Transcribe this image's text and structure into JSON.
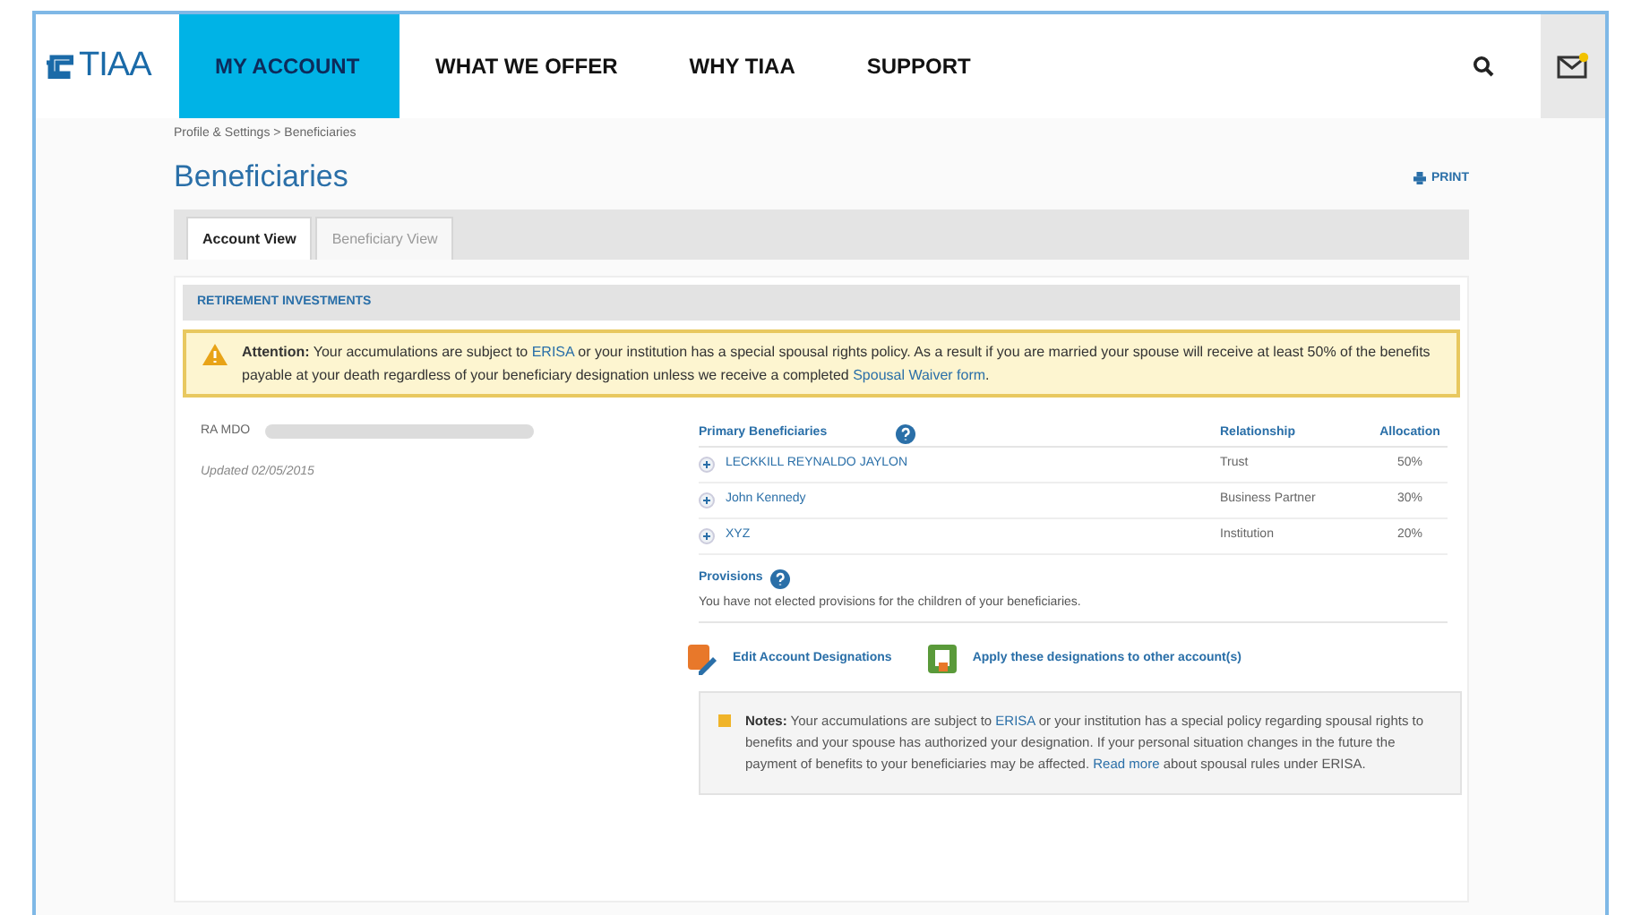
{
  "logo": "TIAA",
  "nav": [
    {
      "label": "MY ACCOUNT",
      "selected": true
    },
    {
      "label": "WHAT WE OFFER",
      "selected": false
    },
    {
      "label": "WHY TIAA",
      "selected": false
    },
    {
      "label": "SUPPORT",
      "selected": false
    }
  ],
  "breadcrumb": "Profile & Settings > Beneficiaries",
  "page_title": "Beneficiaries",
  "print": "PRINT",
  "tabs": [
    {
      "label": "Account View",
      "selected": true
    },
    {
      "label": "Beneficiary View",
      "selected": false
    }
  ],
  "section_title": "RETIREMENT INVESTMENTS",
  "attention": {
    "lead": "Attention:",
    "parts": [
      {
        "kind": "text",
        "text": " Your accumulations are subject to "
      },
      {
        "kind": "link",
        "text": "ERISA"
      },
      {
        "kind": "text",
        "text": " or your institution has a special spousal rights policy. As a result if you are married your spouse will receive at least 50% of the benefits payable at your death regardless of your beneficiary designation unless we receive a completed "
      },
      {
        "kind": "link",
        "text": "Spousal Waiver form"
      },
      {
        "kind": "text",
        "text": "."
      }
    ]
  },
  "account": {
    "label": "RA MDO",
    "updated": "Updated 02/05/2015"
  },
  "beneficiaries": {
    "columns": [
      "Primary Beneficiaries",
      "Relationship",
      "Allocation"
    ],
    "rows": [
      {
        "name": "LECKKILL REYNALDO JAYLON",
        "relationship": "Trust",
        "allocation": "50%"
      },
      {
        "name": "John Kennedy",
        "relationship": "Business Partner",
        "allocation": "30%"
      },
      {
        "name": "XYZ",
        "relationship": "Institution",
        "allocation": "20%"
      }
    ]
  },
  "provisions": {
    "title": "Provisions",
    "text": "You have not elected provisions for the children of your beneficiaries."
  },
  "actions": [
    "Edit Account Designations",
    "Apply these designations to other account(s)"
  ],
  "notes": {
    "lead": "Notes:",
    "parts": [
      {
        "kind": "text",
        "text": " Your accumulations are subject to "
      },
      {
        "kind": "link",
        "text": "ERISA"
      },
      {
        "kind": "text",
        "text": " or your institution has a special policy regarding spousal rights to benefits and your spouse has authorized your designation. If your personal situation changes in the future the payment of benefits to your beneficiaries may be affected. "
      },
      {
        "kind": "link",
        "text": "Read more"
      },
      {
        "kind": "text",
        "text": " about spousal rules under ERISA."
      }
    ]
  }
}
